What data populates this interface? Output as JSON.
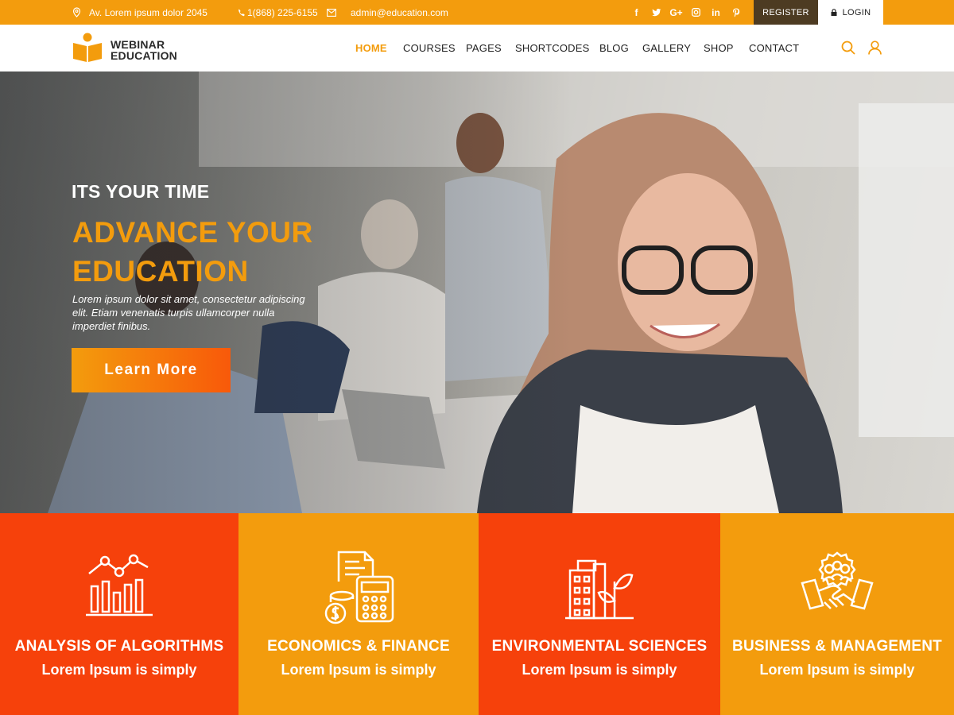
{
  "topbar": {
    "address": "Av. Lorem ipsum dolor 2045",
    "phone": "1(868) 225-6155",
    "email": "admin@education.com",
    "social": [
      "facebook-icon",
      "twitter-icon",
      "google-plus-icon",
      "instagram-icon",
      "linkedin-icon",
      "pinterest-icon"
    ],
    "register_label": "REGISTER",
    "login_label": "LOGIN"
  },
  "header": {
    "logo_line1": "WEBINAR",
    "logo_line2": "EDUCATION",
    "nav": [
      "HOME",
      "COURSES",
      "PAGES",
      "SHORTCODES",
      "BLOG",
      "GALLERY",
      "SHOP",
      "CONTACT"
    ],
    "active_nav": "HOME",
    "icons": [
      "search-icon",
      "user-icon"
    ]
  },
  "hero": {
    "kicker": "ITS YOUR TIME",
    "title": "ADVANCE YOUR EDUCATION",
    "text": "Lorem ipsum dolor sit amet, consectetur adipiscing elit. Etiam venenatis turpis ullamcorper nulla imperdiet finibus.",
    "button_label": "Learn More"
  },
  "features": [
    {
      "title": "ANALYSIS OF ALGORITHMS",
      "subtitle": "Lorem Ipsum is simply",
      "icon": "analytics-chart-icon",
      "color": "#f6410b"
    },
    {
      "title": "ECONOMICS & FINANCE",
      "subtitle": "Lorem Ipsum is simply",
      "icon": "calculator-coins-icon",
      "color": "#f39c0d"
    },
    {
      "title": "ENVIRONMENTAL SCIENCES",
      "subtitle": "Lorem Ipsum is simply",
      "icon": "building-plant-icon",
      "color": "#f6410b"
    },
    {
      "title": "BUSINESS & MANAGEMENT",
      "subtitle": "Lorem Ipsum is simply",
      "icon": "handshake-team-icon",
      "color": "#f39c0d"
    }
  ],
  "colors": {
    "accent": "#f39c0d",
    "accent_red": "#f6410b",
    "register_bg": "#4d3b22"
  }
}
